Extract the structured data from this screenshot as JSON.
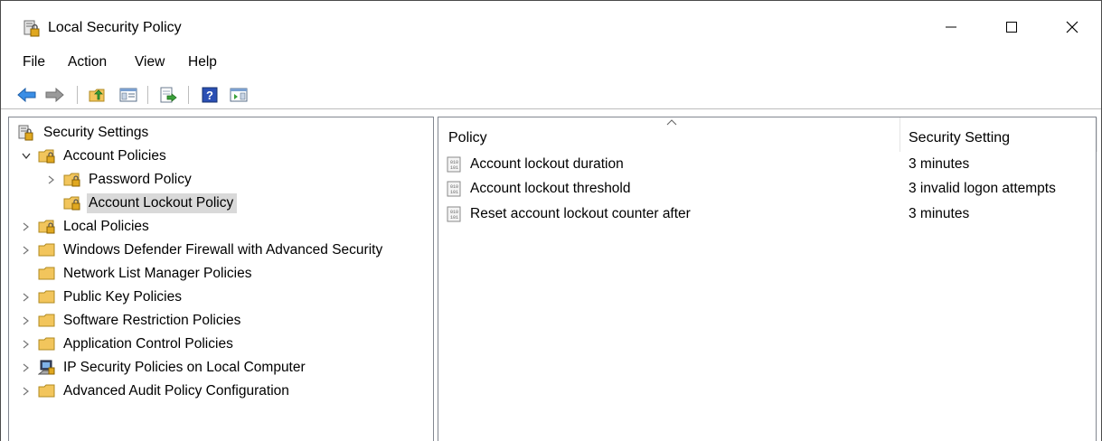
{
  "window": {
    "title": "Local Security Policy"
  },
  "menu": [
    "File",
    "Action",
    "View",
    "Help"
  ],
  "toolbar": {
    "buttons": [
      "back-icon",
      "forward-icon",
      "up-folder-icon",
      "show-hide-tree-icon",
      "export-list-icon",
      "help-icon",
      "show-action-pane-icon"
    ]
  },
  "tree": {
    "root": "Security Settings",
    "items": [
      {
        "label": "Account Policies"
      },
      {
        "label": "Password Policy"
      },
      {
        "label": "Account Lockout Policy"
      },
      {
        "label": "Local Policies"
      },
      {
        "label": "Windows Defender Firewall with Advanced Security"
      },
      {
        "label": "Network List Manager Policies"
      },
      {
        "label": "Public Key Policies"
      },
      {
        "label": "Software Restriction Policies"
      },
      {
        "label": "Application Control Policies"
      },
      {
        "label": "IP Security Policies on Local Computer"
      },
      {
        "label": "Advanced Audit Policy Configuration"
      }
    ],
    "selected": "Account Lockout Policy"
  },
  "list": {
    "columns": [
      "Policy",
      "Security Setting"
    ],
    "rows": [
      {
        "policy": "Account lockout duration",
        "setting": "3 minutes"
      },
      {
        "policy": "Account lockout threshold",
        "setting": "3 invalid logon attempts"
      },
      {
        "policy": "Reset account lockout counter after",
        "setting": "3 minutes"
      }
    ]
  },
  "colors": {
    "selection": "#d9d9d9",
    "folder": "#f2c55c",
    "border": "#828790"
  }
}
